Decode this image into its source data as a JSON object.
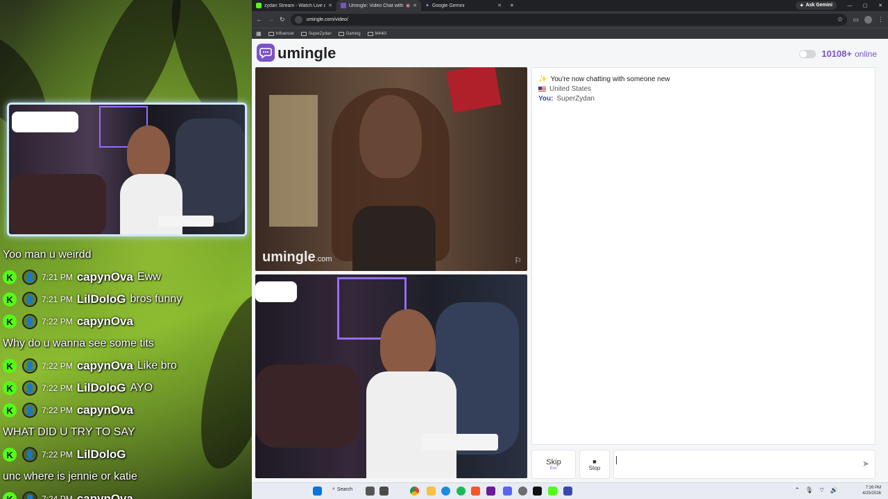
{
  "chat": {
    "messages": [
      {
        "type": "text",
        "text": "Yoo man u weirdd"
      },
      {
        "type": "msg",
        "time": "7:21 PM",
        "user": "capynOva",
        "text": "Eww"
      },
      {
        "type": "msg",
        "time": "7:21 PM",
        "user": "LilDoloG",
        "text": "bros funny"
      },
      {
        "type": "msg",
        "time": "7:22 PM",
        "user": "capynOva",
        "text": ""
      },
      {
        "type": "text",
        "text": "Why do u wanna see some tits"
      },
      {
        "type": "msg",
        "time": "7:22 PM",
        "user": "capynOva",
        "text": "Like bro"
      },
      {
        "type": "msg",
        "time": "7:22 PM",
        "user": "LilDoloG",
        "text": "AYO"
      },
      {
        "type": "msg",
        "time": "7:22 PM",
        "user": "capynOva",
        "text": ""
      },
      {
        "type": "text",
        "text": "WHAT DID U TRY TO SAY"
      },
      {
        "type": "msg",
        "time": "7:22 PM",
        "user": "LilDoloG",
        "text": ""
      },
      {
        "type": "text",
        "text": "unc where is jennie or katie"
      },
      {
        "type": "msg",
        "time": "7:24 PM",
        "user": "capynOva",
        "text": ""
      }
    ]
  },
  "browser": {
    "tabs": [
      {
        "title": "zydan Stream - Watch Live on K",
        "color": "#53fc18"
      },
      {
        "title": "Umingle: Video Chat with S",
        "color": "#7b52c8"
      },
      {
        "title": "Google Gemini",
        "color": "#6d8cf5"
      }
    ],
    "ask_gemini": "Ask Gemini",
    "url": "umingle.com/video/",
    "bookmarks": [
      "Influencer",
      "SuperZydan",
      "Gaming",
      "M440i"
    ]
  },
  "umingle": {
    "logo": "umingle",
    "online_count": "10108+",
    "online_label": "online",
    "watermark_main": "umingle",
    "watermark_tld": ".com",
    "system_message": "You're now chatting with someone new",
    "country": "United States",
    "you_label": "You:",
    "you_name": "SuperZydan",
    "skip_label": "Skip",
    "skip_hint": "Esc",
    "stop_label": "Stop"
  },
  "taskbar": {
    "search_label": "Search",
    "time": "7:26 PM",
    "date": "4/25/2026"
  },
  "colors": {
    "accent": "#7b52c8",
    "kick_green": "#53fc18"
  }
}
